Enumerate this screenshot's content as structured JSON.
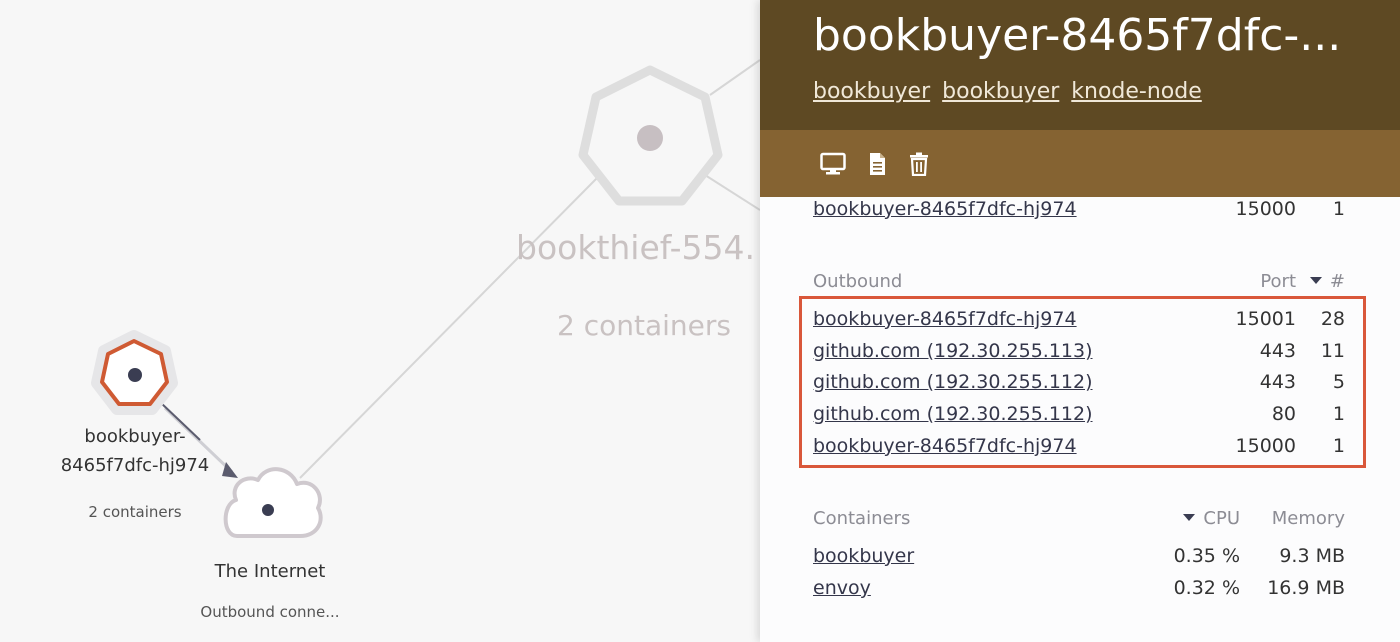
{
  "graph": {
    "nodes": {
      "bookbuyer": {
        "label_line1": "bookbuyer-",
        "label_line2": "8465f7dfc-hj974",
        "sub": "2 containers"
      },
      "internet": {
        "label": "The Internet",
        "sub": "Outbound conne..."
      },
      "bookthief": {
        "label": "bookthief-554.",
        "sub": "2 containers"
      }
    },
    "colors": {
      "selected_node": "#cf5a33",
      "edge": "#d6d6d6"
    }
  },
  "panel": {
    "title": "bookbuyer-8465f7dfc-...",
    "tags": [
      "bookbuyer",
      "bookbuyer",
      "knode-node"
    ],
    "toolbar": {
      "terminal_icon": "monitor-icon",
      "logs_icon": "document-icon",
      "delete_icon": "trash-icon"
    },
    "colors": {
      "header": "#5e4923",
      "toolbar": "#856332",
      "highlight": "#d9573a"
    },
    "inbound_last_row": {
      "name": "bookbuyer-8465f7dfc-hj974",
      "port": "15000",
      "count": "1"
    },
    "outbound": {
      "header": {
        "label": "Outbound",
        "port": "Port",
        "count": "#"
      },
      "rows": [
        {
          "name": "bookbuyer-8465f7dfc-hj974",
          "port": "15001",
          "count": "28"
        },
        {
          "name": "github.com (192.30.255.113)",
          "port": "443",
          "count": "11"
        },
        {
          "name": "github.com (192.30.255.112)",
          "port": "443",
          "count": "5"
        },
        {
          "name": "github.com (192.30.255.112)",
          "port": "80",
          "count": "1"
        },
        {
          "name": "bookbuyer-8465f7dfc-hj974",
          "port": "15000",
          "count": "1"
        }
      ]
    },
    "containers": {
      "header": {
        "label": "Containers",
        "cpu": "CPU",
        "memory": "Memory"
      },
      "rows": [
        {
          "name": "bookbuyer",
          "cpu": "0.35 %",
          "memory": "9.3 MB"
        },
        {
          "name": "envoy",
          "cpu": "0.32 %",
          "memory": "16.9 MB"
        }
      ]
    }
  }
}
